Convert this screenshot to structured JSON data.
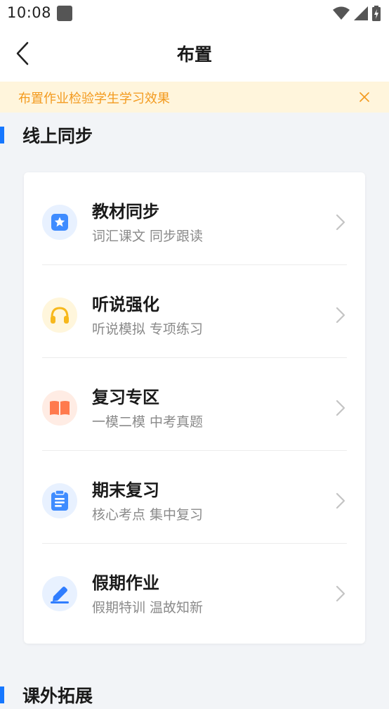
{
  "status_bar": {
    "time": "10:08"
  },
  "nav": {
    "title": "布置"
  },
  "notice": {
    "text": "布置作业检验学生学习效果"
  },
  "sections": {
    "online": {
      "title": "线上同步"
    },
    "extra": {
      "title": "课外拓展"
    }
  },
  "items": [
    {
      "title": "教材同步",
      "subtitle": "词汇课文 同步跟读",
      "icon": "star-badge-icon",
      "icon_color": "#3f8cff",
      "icon_bg": "#e8f1ff"
    },
    {
      "title": "听说强化",
      "subtitle": "听说模拟 专项练习",
      "icon": "headphones-icon",
      "icon_color": "#f7b81c",
      "icon_bg": "#fff6dc"
    },
    {
      "title": "复习专区",
      "subtitle": "一模二模 中考真题",
      "icon": "open-book-icon",
      "icon_color": "#ff7a4d",
      "icon_bg": "#ffece4"
    },
    {
      "title": "期末复习",
      "subtitle": "核心考点 集中复习",
      "icon": "clipboard-icon",
      "icon_color": "#3f8cff",
      "icon_bg": "#e8f1ff"
    },
    {
      "title": "假期作业",
      "subtitle": "假期特训 温故知新",
      "icon": "pencil-icon",
      "icon_color": "#2f7dff",
      "icon_bg": "#e8f1ff"
    }
  ],
  "colors": {
    "accent": "#1677ff",
    "notice_text": "#f39a1e",
    "notice_bg": "#fff5dc",
    "page_bg": "#f2f4f7"
  }
}
